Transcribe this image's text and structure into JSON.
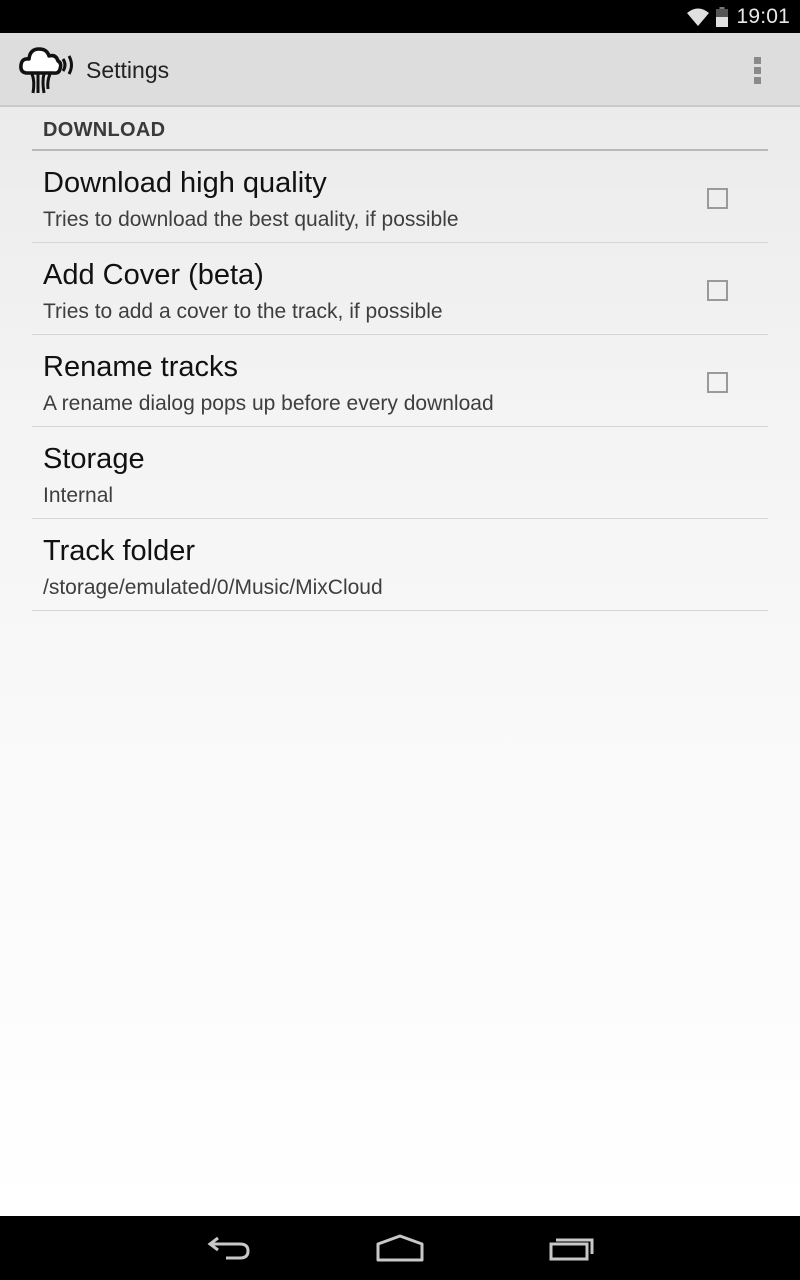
{
  "status_bar": {
    "time": "19:01",
    "icons": [
      "wifi-icon",
      "battery-icon"
    ]
  },
  "action_bar": {
    "app_icon": "cloud-broadcast-icon",
    "title": "Settings",
    "overflow_icon": "more-vert-icon"
  },
  "preferences": {
    "category": "DOWNLOAD",
    "items": [
      {
        "title": "Download high quality",
        "summary": "Tries to download the best quality, if possible",
        "type": "checkbox",
        "checked": false
      },
      {
        "title": "Add Cover (beta)",
        "summary": "Tries to add a cover to the track, if possible",
        "type": "checkbox",
        "checked": false
      },
      {
        "title": "Rename tracks",
        "summary": "A rename dialog pops up before every download",
        "type": "checkbox",
        "checked": false
      },
      {
        "title": "Storage",
        "summary": "Internal",
        "type": "list"
      },
      {
        "title": "Track folder",
        "summary": "/storage/emulated/0/Music/MixCloud",
        "type": "text"
      }
    ]
  },
  "nav_bar": {
    "buttons": [
      "back-icon",
      "home-icon",
      "recents-icon"
    ]
  },
  "colors": {
    "action_bar_bg": "#dddddd",
    "status_bar_bg": "#000000",
    "category_text": "#3a3a3a"
  }
}
